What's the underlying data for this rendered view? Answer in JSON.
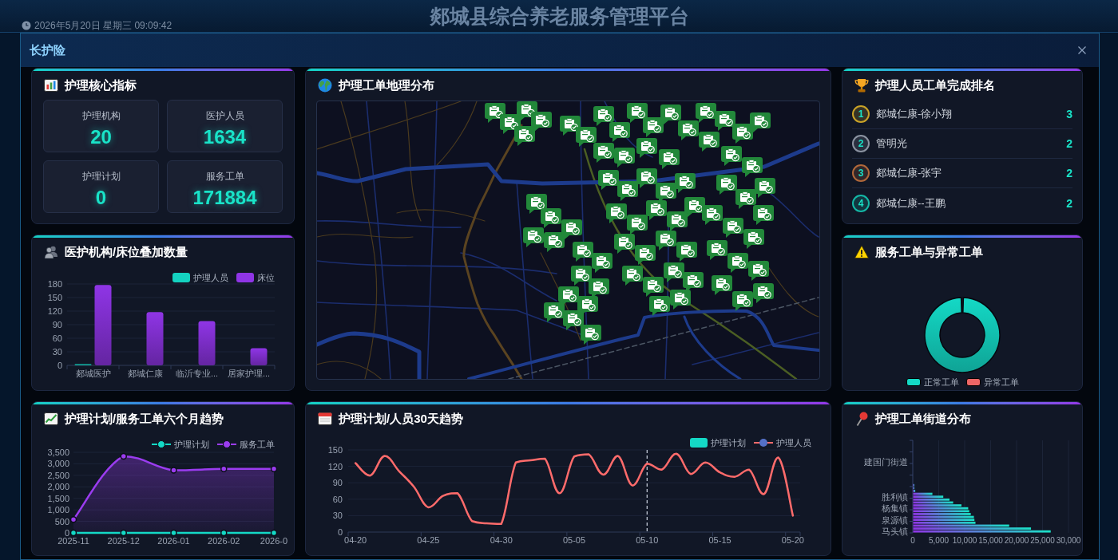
{
  "backdrop": {
    "platform_title": "郯城县综合养老服务管理平台",
    "datetime": "2026年5月20日 星期三 09:09:42"
  },
  "dialog": {
    "title": "长护险",
    "core_metrics": {
      "title": "护理核心指标",
      "metrics": [
        {
          "label": "护理机构",
          "value": "20"
        },
        {
          "label": "医护人员",
          "value": "1634"
        },
        {
          "label": "护理计划",
          "value": "0"
        },
        {
          "label": "服务工单",
          "value": "171884"
        }
      ]
    },
    "work_order_map": {
      "title": "护理工单地理分布"
    },
    "staff_ranking": {
      "title": "护理人员工单完成排名",
      "rows": [
        {
          "rank": "1",
          "name": "郯城仁康-徐小翔",
          "count": "3",
          "color": "#c9a227"
        },
        {
          "rank": "2",
          "name": "管明光",
          "count": "2",
          "color": "#8b93a1"
        },
        {
          "rank": "3",
          "name": "郯城仁康-张宇",
          "count": "2",
          "color": "#b0683a"
        },
        {
          "rank": "4",
          "name": "郯城仁康--王鹏",
          "count": "2",
          "color": "#14b8a6"
        }
      ]
    },
    "institution_beds": {
      "title": "医护机构/床位叠加数量",
      "chart_data": {
        "type": "bar",
        "categories": [
          "郯城医护",
          "郯城仁康",
          "临沂专业...",
          "居家护理..."
        ],
        "series": [
          {
            "name": "护理人员",
            "color": "#14d2c0",
            "values": [
              1,
              0,
              0,
              0
            ]
          },
          {
            "name": "床位",
            "color": "#8f35e6",
            "values": [
              178,
              118,
              98,
              38
            ]
          }
        ],
        "ylim": [
          0,
          180
        ],
        "yticks": [
          0,
          30,
          60,
          90,
          120,
          150,
          180
        ],
        "grid": true,
        "legend": true
      }
    },
    "service_vs_abnormal": {
      "title": "服务工单与异常工单",
      "legend": [
        {
          "label": "正常工单",
          "color": "#14d9c6"
        },
        {
          "label": "异常工单",
          "color": "#ee6666"
        }
      ]
    },
    "six_month_trend": {
      "title": "护理计划/服务工单六个月趋势",
      "chart_data": {
        "type": "line",
        "categories": [
          "2025-11",
          "2025-12",
          "2026-01",
          "2026-02",
          "2026-0"
        ],
        "series": [
          {
            "name": "护理计划",
            "type": "line",
            "color": "#14d9c6",
            "marker": "circle",
            "values": [
              0,
              0,
              0,
              0,
              0
            ]
          },
          {
            "name": "服务工单",
            "type": "area",
            "color": "#9b3cf0",
            "marker": "circle",
            "values": [
              580,
              3330,
              2720,
              2780,
              2780
            ]
          }
        ],
        "ylim": [
          0,
          3500
        ],
        "yticks": [
          0,
          500,
          {
            "value": 1000,
            "label": "1,000"
          },
          {
            "value": 1500,
            "label": "1,500"
          },
          {
            "value": 2000,
            "label": "2,000"
          },
          {
            "value": 2500,
            "label": "2,500"
          },
          {
            "value": 3000,
            "label": "3,000"
          },
          {
            "value": 3500,
            "label": "3,500"
          }
        ],
        "grid": true,
        "legend": true
      }
    },
    "thirty_day_trend": {
      "title": "护理计划/人员30天趋势",
      "chart_data": {
        "type": "line",
        "categories": [
          "04-20",
          null,
          null,
          null,
          null,
          "04-25",
          null,
          null,
          null,
          null,
          "04-30",
          null,
          null,
          null,
          null,
          "05-05",
          null,
          null,
          null,
          null,
          "05-10",
          null,
          null,
          null,
          null,
          "05-15",
          null,
          null,
          null,
          null,
          "05-20"
        ],
        "series": [
          {
            "name": "护理计划",
            "type": "bar",
            "color": "#14d9c6",
            "values": [
              null,
              null,
              null,
              null,
              null,
              null,
              null,
              null,
              null,
              null,
              null,
              null,
              null,
              null,
              null,
              null,
              null,
              null,
              null,
              null,
              null,
              null,
              null,
              null,
              null,
              null,
              null,
              null,
              null,
              null,
              null
            ]
          },
          {
            "name": "护理人员",
            "type": "line",
            "color": "#ff6b6b",
            "values": [
              126,
              103,
              139,
              111,
              83,
              45,
              66,
              71,
              20,
              16,
              15,
              127,
              131,
              134,
              71,
              138,
              142,
              105,
              139,
              85,
              125,
              114,
              143,
              106,
              127,
              109,
              101,
              114,
              69,
              136,
              30
            ]
          }
        ],
        "ylim": [
          0,
          150
        ],
        "yticks": [
          0,
          30,
          60,
          90,
          120,
          150
        ],
        "grid": true,
        "legend": true,
        "ref_lines": [
          {
            "axis": "x",
            "value": "05-10"
          }
        ]
      }
    },
    "street_distribution": {
      "title": "护理工单街道分布",
      "chart_data": {
        "type": "bar",
        "orientation": "horizontal",
        "categories": [
          null,
          null,
          null,
          null,
          null,
          null,
          null,
          "建国门街道",
          null,
          null,
          null,
          null,
          null,
          null,
          null,
          null,
          null,
          null,
          null,
          "胜利镇",
          null,
          null,
          null,
          "杨集镇",
          null,
          null,
          null,
          "泉源镇",
          null,
          null,
          null,
          "马头镇"
        ],
        "series": [
          {
            "values": [
              0,
              0,
              0,
              0,
              0,
              0,
              0,
              0,
              0,
              0,
              0,
              0,
              0,
              0,
              0,
              100,
              200,
              400,
              3700,
              5800,
              7000,
              7700,
              9300,
              10600,
              10800,
              11100,
              11700,
              11800,
              12000,
              18500,
              22700,
              26500
            ]
          }
        ],
        "xlim": [
          0,
          30000
        ],
        "xticks": [
          0,
          {
            "value": 5000,
            "label": "5,000"
          },
          {
            "value": 10000,
            "label": "10,000"
          },
          {
            "value": 15000,
            "label": "15,000"
          },
          {
            "value": 20000,
            "label": "20,000"
          },
          {
            "value": 25000,
            "label": "25,000"
          },
          {
            "value": 30000,
            "label": "30,000"
          }
        ],
        "grid": true
      }
    }
  }
}
